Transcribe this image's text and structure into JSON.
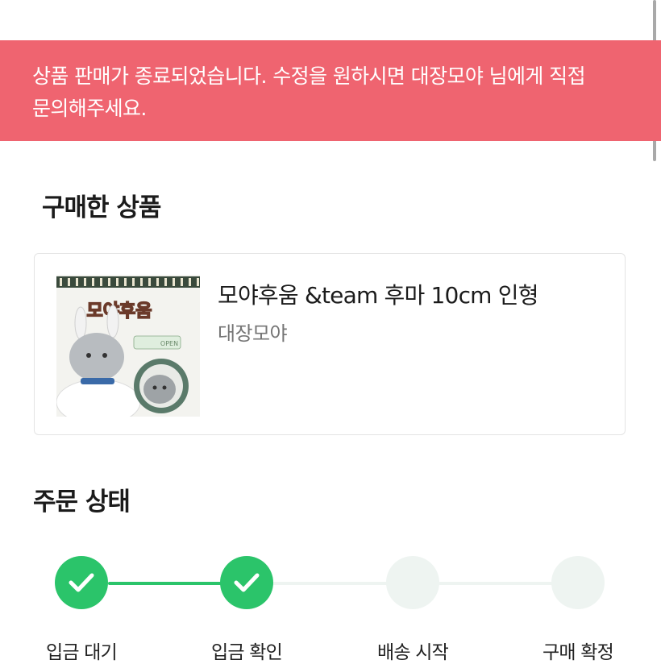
{
  "notice": {
    "line1": "상품 판매가 종료되었습니다. 수정을 원하시면 대장모야 님에게 직접",
    "line2": "문의해주세요."
  },
  "purchased": {
    "title": "구매한 상품",
    "product": {
      "name": "모야후움 &team 후마 10cm 인형",
      "seller": "대장모야",
      "thumb_text": "모야후움",
      "thumb_tag": "OPEN"
    }
  },
  "order": {
    "title": "주문 상태",
    "steps": [
      {
        "label": "입금 대기",
        "done": true
      },
      {
        "label": "입금 확인",
        "done": true
      },
      {
        "label": "배송 시작",
        "done": false
      },
      {
        "label": "구매 확정",
        "done": false
      }
    ]
  },
  "colors": {
    "notice_bg": "#ef6470",
    "accent_green": "#2bc46a",
    "inactive": "#eef4f1"
  }
}
